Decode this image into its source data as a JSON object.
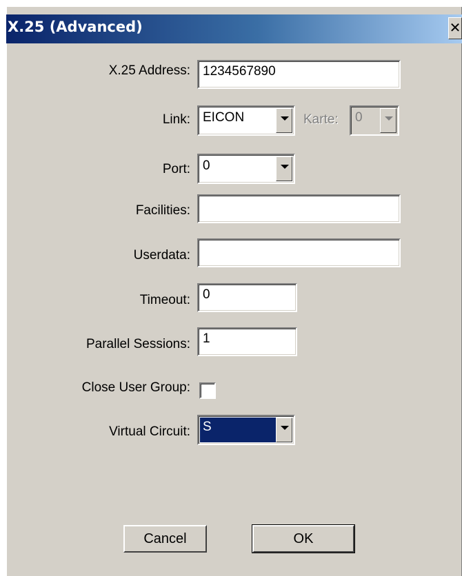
{
  "window": {
    "title": "X.25 (Advanced)",
    "close_glyph": "✕",
    "close_icon": "close-icon",
    "title_gradient": [
      "#0a246a",
      "#a6caf0"
    ]
  },
  "form": {
    "x25_address": {
      "label": "X.25 Address:",
      "value": "1234567890"
    },
    "link": {
      "label": "Link:",
      "value": "EICON"
    },
    "karte": {
      "label": "Karte:",
      "value": "0",
      "enabled": false
    },
    "port": {
      "label": "Port:",
      "value": "0"
    },
    "facilities": {
      "label": "Facilities:",
      "value": ""
    },
    "userdata": {
      "label": "Userdata:",
      "value": ""
    },
    "timeout": {
      "label": "Timeout:",
      "value": "0"
    },
    "parallel_sessions": {
      "label": "Parallel Sessions:",
      "value": "1"
    },
    "close_user_group": {
      "label": "Close User Group:",
      "checked": false
    },
    "virtual_circuit": {
      "label": "Virtual Circuit:",
      "value": "S"
    }
  },
  "buttons": {
    "cancel": "Cancel",
    "ok": "OK"
  },
  "colors": {
    "dialog_face": "#d4d0c8",
    "selection": "#0a246a"
  }
}
